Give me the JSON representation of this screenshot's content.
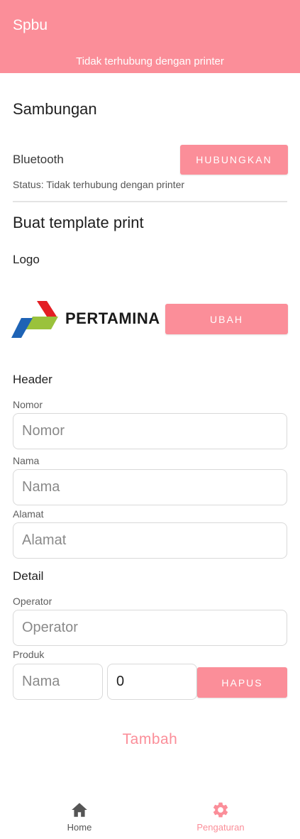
{
  "appbar": {
    "title": "Spbu",
    "subtitle": "Tidak terhubung dengan printer"
  },
  "connection": {
    "section_title": "Sambungan",
    "bluetooth_label": "Bluetooth",
    "connect_button": "HUBUNGKAN",
    "status_text": "Status: Tidak terhubung dengan printer"
  },
  "template": {
    "section_title": "Buat template print",
    "logo_label": "Logo",
    "logo_text": "PERTAMINA",
    "change_button": "UBAH"
  },
  "header": {
    "title": "Header",
    "nomor_label": "Nomor",
    "nomor_placeholder": "Nomor",
    "nama_label": "Nama",
    "nama_placeholder": "Nama",
    "alamat_label": "Alamat",
    "alamat_placeholder": "Alamat"
  },
  "detail": {
    "title": "Detail",
    "operator_label": "Operator",
    "operator_placeholder": "Operator",
    "produk_label": "Produk",
    "produk_nama_placeholder": "Nama",
    "produk_qty_value": "0",
    "delete_button": "HAPUS",
    "add_button": "Tambah"
  },
  "bottom_nav": {
    "home_label": "Home",
    "home_icon": "home-icon",
    "settings_label": "Pengaturan",
    "settings_icon": "gear-icon",
    "active_color": "#fb8e99",
    "inactive_color": "#555555"
  },
  "colors": {
    "accent": "#fb8e99"
  }
}
